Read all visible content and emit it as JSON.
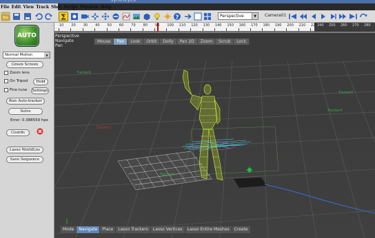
{
  "menu": [
    {
      "label": "File"
    },
    {
      "label": "Edit"
    },
    {
      "label": "View"
    },
    {
      "label": "Track"
    },
    {
      "label": "Shot"
    },
    {
      "label": "Script"
    },
    {
      "label": "Window"
    },
    {
      "label": "Help"
    }
  ],
  "toolbar": {
    "view_select": "Perspective",
    "camera_label": "Camera01"
  },
  "timeline": {
    "ticks": [
      "10",
      "20",
      "30",
      "40",
      "50",
      "60",
      "70",
      "80",
      "90",
      "100",
      "110",
      "120",
      "130",
      "140",
      "150",
      "160",
      "170",
      "180",
      "190",
      "200",
      "210",
      "220"
    ],
    "dark_ticks": [
      "240",
      "250",
      "260",
      "270",
      "280"
    ],
    "playhead_frame": 92
  },
  "left_panel": {
    "auto_label": "AUTO",
    "mode_select": "Normal Motion",
    "green_screen": "Green Screen",
    "zoom_lens": "Zoom lens",
    "on_tripod": "On Tripod",
    "hold": "Hold",
    "fine_tune": "Fine tune",
    "settings": "Settings",
    "run_auto_tracker": "Run Auto-tracker",
    "solve": "Solve",
    "error_text": "Error: 0.388559 hpx",
    "coords": "Coords",
    "lasso_worldlines": "Lasso WorldLns",
    "save_sequence": "Save Sequence"
  },
  "viewport": {
    "title_lines": [
      "Perspective",
      "Navigate",
      "Pan"
    ],
    "nav_tabs": [
      {
        "label": "Mouse",
        "active": false
      },
      {
        "label": "Pan",
        "active": true
      },
      {
        "label": "Look",
        "active": false
      },
      {
        "label": "Orbit",
        "active": false
      },
      {
        "label": "Dolly",
        "active": false
      },
      {
        "label": "Pan 2D",
        "active": false
      },
      {
        "label": "Zoom",
        "active": false
      },
      {
        "label": "Scrub",
        "active": false
      },
      {
        "label": "Lock",
        "active": false
      }
    ],
    "bottom_tabs": [
      {
        "label": "Mode",
        "active": false
      },
      {
        "label": "Navigate",
        "active": true
      },
      {
        "label": "Place",
        "active": false
      },
      {
        "label": "Lasso Trackers",
        "active": false
      },
      {
        "label": "Lasso Vertices",
        "active": false
      },
      {
        "label": "Lasso Entire Meshes",
        "active": false
      },
      {
        "label": "Create",
        "active": false
      }
    ],
    "tracker_labels": [
      {
        "text": "Tracker6",
        "color": "#3aa64a"
      },
      {
        "text": "Tracker8",
        "color": "#3aa64a"
      },
      {
        "text": "Tracker4",
        "color": "#3aa64a"
      },
      {
        "text": "Tracker3",
        "color": "#c0302a"
      },
      {
        "text": "Tracker5",
        "color": "#3aa64a"
      }
    ]
  },
  "colors": {
    "accent_blue": "#5f86b5",
    "mesh_yellow": "#c8e030",
    "tracker_cyan": "#40d8e8",
    "auto_green": "#3f8f2a"
  }
}
